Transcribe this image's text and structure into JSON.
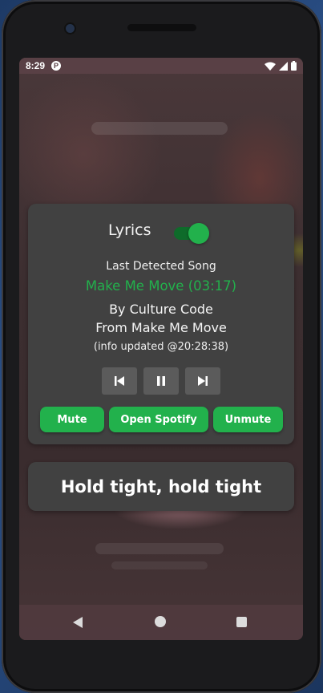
{
  "status_bar": {
    "time": "8:29",
    "app_icon": "P"
  },
  "card": {
    "lyrics_label": "Lyrics",
    "lyrics_toggle_on": true,
    "last_detected_label": "Last Detected Song",
    "song_title": "Make Me Move (03:17)",
    "by_artist": "By Culture Code",
    "from_album": "From Make Me Move",
    "info_updated": "(info updated @20:28:38)",
    "controls": {
      "prev_icon": "skip-previous-icon",
      "pause_icon": "pause-icon",
      "next_icon": "skip-next-icon"
    },
    "buttons": {
      "mute": "Mute",
      "open_spotify": "Open Spotify",
      "unmute": "Unmute"
    }
  },
  "lyric_line": "Hold tight, hold tight",
  "colors": {
    "accent": "#22b14c",
    "card_bg": "#414141",
    "toggle_track": "#0e6b2a"
  },
  "nav": {
    "back_icon": "back-triangle-icon",
    "home_icon": "home-circle-icon",
    "recents_icon": "recents-square-icon"
  }
}
